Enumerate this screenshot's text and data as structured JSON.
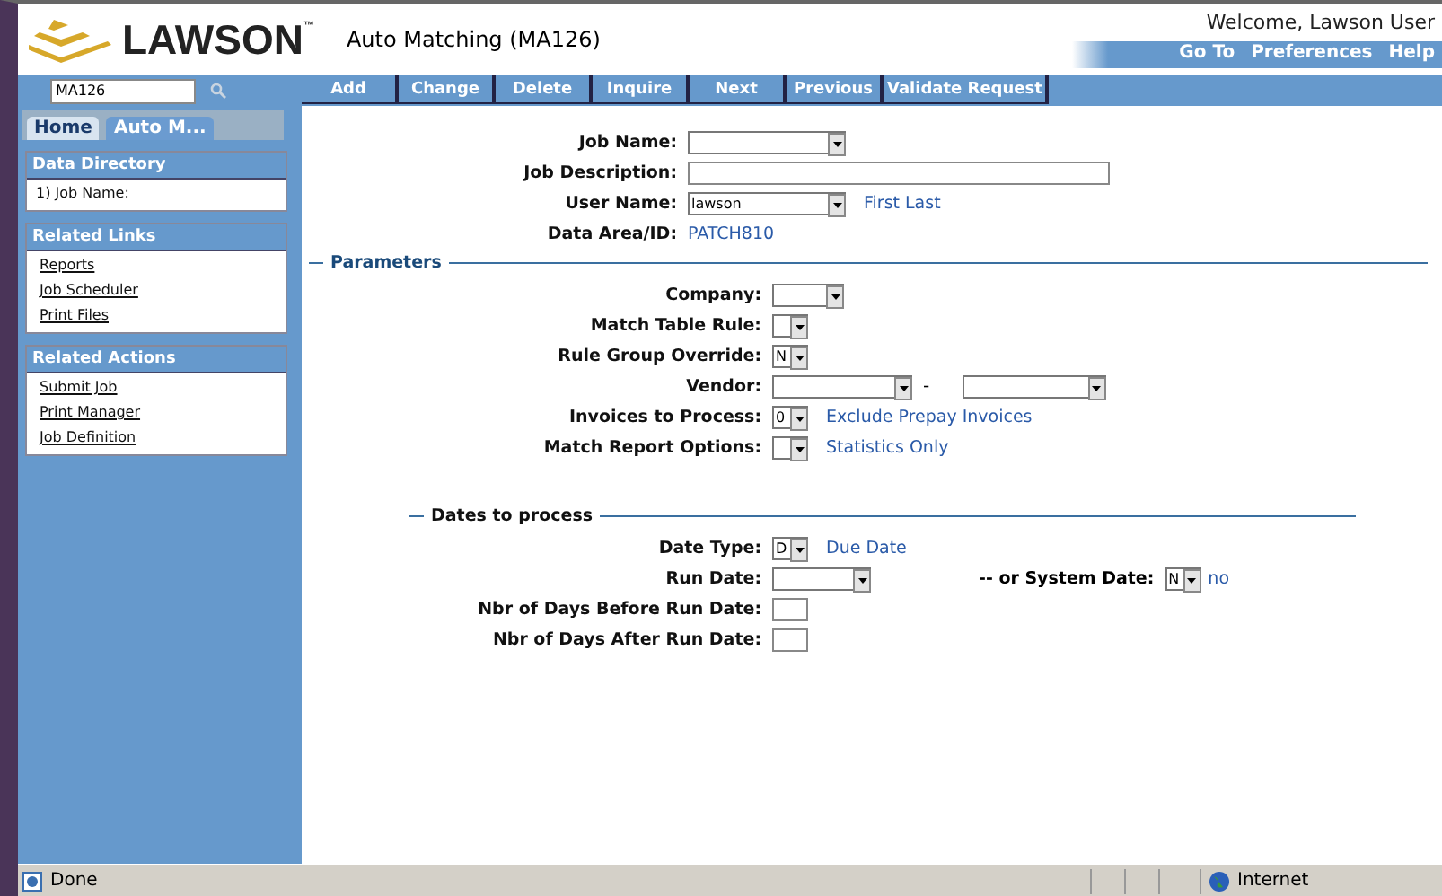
{
  "header": {
    "brand": "LAWSON",
    "trademark": "™",
    "title": "Auto Matching (MA126)",
    "welcome": "Welcome, Lawson User",
    "links": [
      "Go To",
      "Preferences",
      "Help"
    ]
  },
  "search": {
    "value": "MA126"
  },
  "toolbar": [
    "Add",
    "Change",
    "Delete",
    "Inquire",
    "Next",
    "Previous",
    "Validate Request"
  ],
  "tabs": [
    {
      "label": "Home",
      "selected": true
    },
    {
      "label": "Auto M...",
      "selected": false
    }
  ],
  "sidebar": [
    {
      "title": "Data Directory",
      "kind": "text",
      "items": [
        "1) Job Name:"
      ]
    },
    {
      "title": "Related Links",
      "kind": "links",
      "items": [
        "Reports",
        "Job Scheduler",
        "Print Files"
      ]
    },
    {
      "title": "Related Actions",
      "kind": "links",
      "items": [
        "Submit Job",
        "Print Manager",
        "Job Definition"
      ]
    }
  ],
  "header_fields": [
    {
      "label": "Job Name:",
      "kind": "combo-long"
    },
    {
      "label": "Job Description:",
      "kind": "text-wide"
    },
    {
      "label": "User Name:",
      "kind": "combo-long",
      "value": "lawson",
      "note": "First Last"
    },
    {
      "label": "Data Area/ID:",
      "kind": "plain",
      "note": "PATCH810"
    }
  ],
  "parameters": {
    "legend": "Parameters",
    "fields": [
      {
        "label": "Company:",
        "kind": "combo-short"
      },
      {
        "label": "Match Table Rule:",
        "kind": "combo-tiny"
      },
      {
        "label": "Rule Group Override:",
        "kind": "combo-tiny",
        "value": "N"
      },
      {
        "label": "Vendor:",
        "kind": "range",
        "separator": "-"
      },
      {
        "label": "Invoices to Process:",
        "kind": "combo-tiny",
        "value": "0",
        "note": "Exclude Prepay Invoices"
      },
      {
        "label": "Match Report Options:",
        "kind": "combo-tiny",
        "note": "Statistics Only"
      }
    ]
  },
  "dates": {
    "legend": "Dates to process",
    "fields": [
      {
        "label": "Date Type:",
        "kind": "combo-tiny",
        "value": "D",
        "note": "Due Date"
      },
      {
        "label": "Run Date:",
        "kind": "combo-mid",
        "extra": {
          "label": "-- or System Date:",
          "value": "N",
          "note": "no"
        }
      },
      {
        "label": "Nbr of Days Before Run Date:",
        "kind": "text-tiny"
      },
      {
        "label": "Nbr of Days After Run Date:",
        "kind": "text-tiny"
      }
    ]
  },
  "status_bar": {
    "text": "Done",
    "zone": "Internet"
  }
}
